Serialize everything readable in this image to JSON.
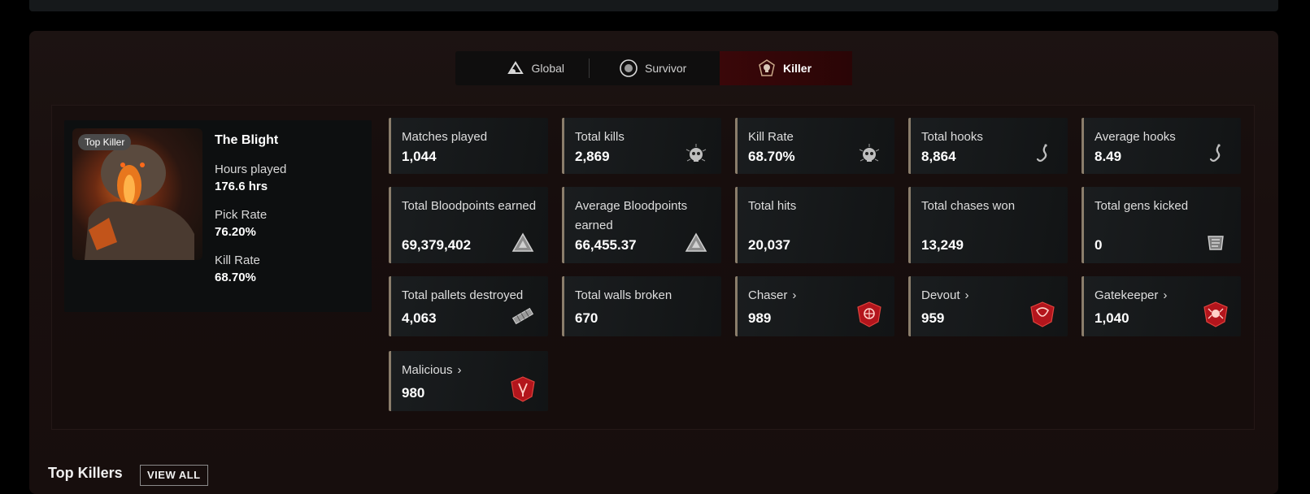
{
  "tabs": [
    {
      "label": "Global",
      "icon": "global-icon"
    },
    {
      "label": "Survivor",
      "icon": "survivor-icon"
    },
    {
      "label": "Killer",
      "icon": "killer-skull-icon",
      "active": true
    }
  ],
  "killer": {
    "badge": "Top Killer",
    "name": "The Blight",
    "hours_label": "Hours played",
    "hours_value": "176.6 hrs",
    "pick_label": "Pick Rate",
    "pick_value": "76.20%",
    "kill_label": "Kill Rate",
    "kill_value": "68.70%"
  },
  "stats": [
    {
      "label": "Matches played",
      "value": "1,044",
      "icon": ""
    },
    {
      "label": "Total kills",
      "value": "2,869",
      "icon": "skull-icon"
    },
    {
      "label": "Kill Rate",
      "value": "68.70%",
      "icon": "skull-icon"
    },
    {
      "label": "Total hooks",
      "value": "8,864",
      "icon": "hook-icon"
    },
    {
      "label": "Average hooks",
      "value": "8.49",
      "icon": "hook-icon"
    },
    {
      "label": "Total Bloodpoints earned",
      "value": "69,379,402",
      "icon": "bloodpoints-icon"
    },
    {
      "label": "Average Bloodpoints earned",
      "value": "66,455.37",
      "icon": "bloodpoints-icon"
    },
    {
      "label": "Total hits",
      "value": "20,037",
      "icon": ""
    },
    {
      "label": "Total chases won",
      "value": "13,249",
      "icon": ""
    },
    {
      "label": "Total gens kicked",
      "value": "0",
      "icon": "generator-icon"
    },
    {
      "label": "Total pallets destroyed",
      "value": "4,063",
      "icon": "pallet-icon"
    },
    {
      "label": "Total walls broken",
      "value": "670",
      "icon": ""
    },
    {
      "label": "Chaser",
      "value": "989",
      "icon": "chaser-emblem-icon",
      "link": true
    },
    {
      "label": "Devout",
      "value": "959",
      "icon": "devout-emblem-icon",
      "link": true
    },
    {
      "label": "Gatekeeper",
      "value": "1,040",
      "icon": "gatekeeper-emblem-icon",
      "link": true
    },
    {
      "label": "Malicious",
      "value": "980",
      "icon": "malicious-emblem-icon",
      "link": true
    }
  ],
  "bottom": {
    "title": "Top Killers",
    "view_all": "VIEW ALL"
  },
  "colors": {
    "accent_red": "#c0141c",
    "stat_border": "#8a7d6b"
  }
}
